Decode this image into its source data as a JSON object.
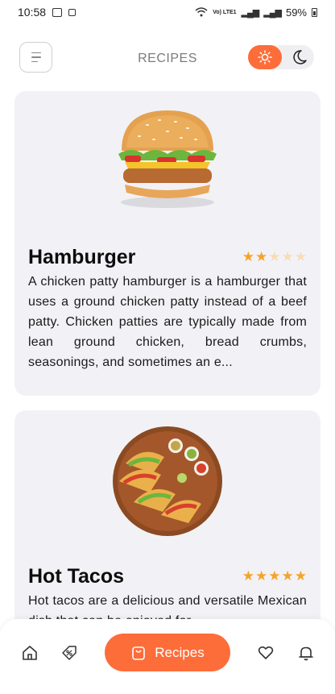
{
  "status_bar": {
    "time": "10:58",
    "battery": "59%",
    "network": "Vo) LTE1"
  },
  "header": {
    "title": "RECIPES",
    "theme_active": "light"
  },
  "recipes": [
    {
      "name": "Hamburger",
      "rating": 2,
      "max_rating": 5,
      "description": "A chicken patty hamburger is a hamburger that uses a ground chicken patty instead of a beef patty. Chicken patties are typically made from lean ground chicken, bread crumbs, seasonings, and sometimes an e..."
    },
    {
      "name": "Hot Tacos",
      "rating": 5,
      "max_rating": 5,
      "description": "Hot tacos are a delicious and versatile Mexican dish that can be enjoyed for"
    }
  ],
  "bottom_nav": {
    "recipes_label": "Recipes",
    "active": "recipes"
  },
  "colors": {
    "accent": "#fd6d3a",
    "star_on": "#f6a32b",
    "star_off": "#f9dcb8",
    "card_bg": "#f2f2f6"
  }
}
